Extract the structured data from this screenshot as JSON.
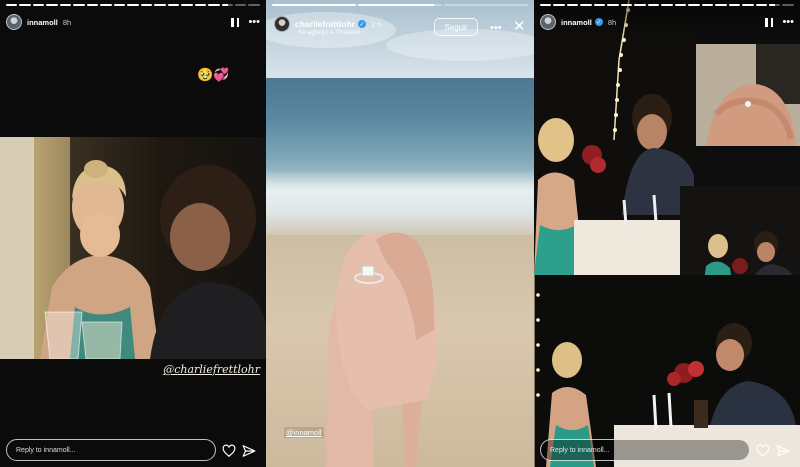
{
  "story1": {
    "username": "innamoll",
    "time": "8h",
    "mention": "@charliefrettlohr",
    "reply_placeholder": "Reply to innamoll...",
    "progress": [
      1,
      1,
      1,
      1,
      1,
      1,
      1,
      1,
      1,
      1,
      1,
      1,
      1,
      1,
      1,
      1,
      0.6,
      0,
      0
    ]
  },
  "story2": {
    "username": "charliefrettlohr",
    "time": "2 h",
    "subtitle": "Se agregó a Thailand ›",
    "follow_label": "Seguir",
    "mention": "@innamoll",
    "progress": [
      1,
      0.9,
      0
    ]
  },
  "story3": {
    "username": "innamoll",
    "time": "8h",
    "reply_placeholder": "Reply to innamoll...",
    "progress": [
      1,
      1,
      1,
      1,
      1,
      1,
      1,
      1,
      1,
      1,
      1,
      1,
      1,
      1,
      1,
      1,
      1,
      0.5,
      0
    ]
  },
  "icons": {
    "pause": "pause-icon",
    "more": "more-options-icon",
    "heart": "heart-icon",
    "send": "send-icon",
    "close": "close-icon"
  },
  "colors": {
    "verified": "#3897f0",
    "story_bg": "#0b0b0b"
  }
}
